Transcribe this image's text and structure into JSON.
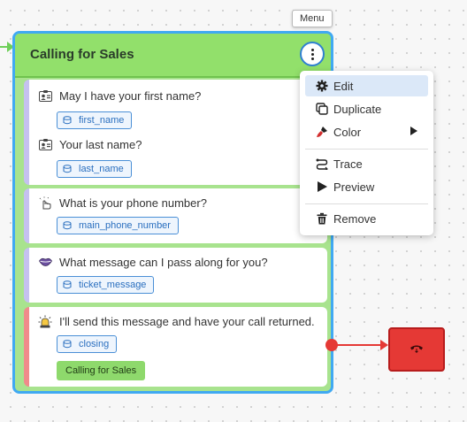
{
  "node": {
    "title": "Calling for Sales",
    "menu_tooltip": "Menu"
  },
  "cards": [
    {
      "icon": "contact-card-icon",
      "items": [
        {
          "question": "May I have your first name?",
          "variable": "first_name"
        },
        {
          "question": "Your last name?",
          "variable": "last_name"
        }
      ]
    },
    {
      "icon": "touch-icon",
      "items": [
        {
          "question": "What is your phone number?",
          "variable": "main_phone_number"
        }
      ]
    },
    {
      "icon": "lips-icon",
      "items": [
        {
          "question": "What message can I pass along for you?",
          "variable": "ticket_message"
        }
      ]
    },
    {
      "icon": "alarm-light-icon",
      "items": [
        {
          "question": "I'll send this message and have your call returned.",
          "variable": "closing"
        }
      ],
      "badge": "Calling for Sales"
    }
  ],
  "context_menu": {
    "items": [
      {
        "label": "Edit",
        "icon": "gear-icon",
        "highlighted": true
      },
      {
        "label": "Duplicate",
        "icon": "duplicate-icon"
      },
      {
        "label": "Color",
        "icon": "paint-brush-icon",
        "submenu": true
      },
      {
        "label": "Trace",
        "icon": "trace-icon"
      },
      {
        "label": "Preview",
        "icon": "play-icon"
      },
      {
        "label": "Remove",
        "icon": "trash-icon"
      }
    ]
  },
  "hangup_node": {
    "icon": "hang-up-phone-icon"
  },
  "colors": {
    "node_header": "#92e06b",
    "node_border": "#40a9f2",
    "variable_chip": "#2a6fbf",
    "hangup": "#e53935",
    "card_accent_purple": "#c5c1f0",
    "card_accent_red": "#f08b8b"
  }
}
